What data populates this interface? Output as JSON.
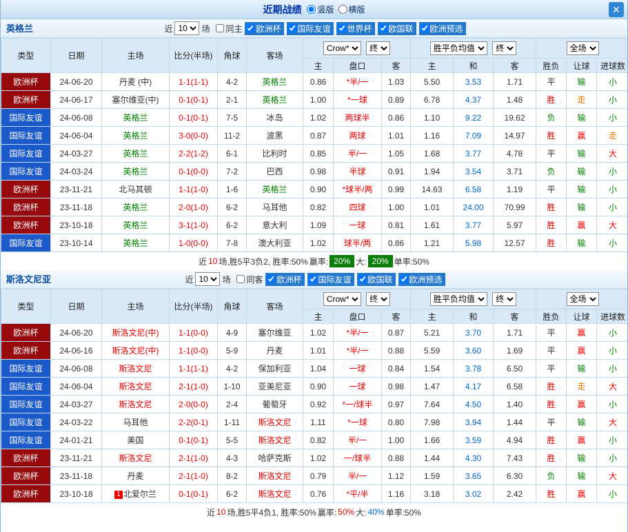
{
  "topbar": {
    "title": "近期战绩",
    "radios": [
      {
        "label": "竖版",
        "selected": true
      },
      {
        "label": "横版",
        "selected": false
      }
    ],
    "close_glyph": "✕"
  },
  "table_header": {
    "col_type": "类型",
    "col_date": "日期",
    "col_home": "主场",
    "col_score": "比分(半场)",
    "col_corner": "角球",
    "col_away": "客场",
    "dd_company": "Crow*",
    "dd_final1": "终",
    "dd_avg": "胜平负均值",
    "dd_final2": "终",
    "dd_scope": "全场",
    "sub": [
      "主",
      "盘口",
      "客",
      "主",
      "和",
      "客",
      "胜负",
      "让球",
      "进球数"
    ]
  },
  "comp_colors": {
    "欧洲杯": "#96090d",
    "国际友谊": "#1d5ac9"
  },
  "sections": [
    {
      "team": "英格兰",
      "filters": {
        "near": "近",
        "count": "10",
        "unit": "场",
        "same_label": "同主",
        "same_checked": false,
        "comps": [
          "欧洲杯",
          "国际友谊",
          "世界杯",
          "欧国联",
          "欧洲预选"
        ]
      },
      "rows": [
        {
          "comp": "欧洲杯",
          "date": "24-06-20",
          "home": "丹麦 (中)",
          "home_color": "black",
          "score": "1-1(1-1)",
          "corner": "4-2",
          "away": "英格兰",
          "away_color": "green",
          "odds_home": "0.86",
          "handicap": "*半/一",
          "odds_away": "1.03",
          "avg_home": "5.50",
          "avg_draw": "3.53",
          "avg_away": "1.71",
          "result": "平",
          "result_color": "black",
          "hcp": "输",
          "hcp_color": "green",
          "goal": "小",
          "goal_color": "green"
        },
        {
          "comp": "欧洲杯",
          "date": "24-06-17",
          "home": "塞尔维亚(中)",
          "home_color": "black",
          "score": "0-1(0-1)",
          "corner": "2-1",
          "away": "英格兰",
          "away_color": "green",
          "odds_home": "1.00",
          "handicap": "*一球",
          "odds_away": "0.89",
          "avg_home": "6.78",
          "avg_draw": "4.37",
          "avg_away": "1.48",
          "result": "胜",
          "result_color": "red",
          "hcp": "走",
          "hcp_color": "orange",
          "goal": "小",
          "goal_color": "green"
        },
        {
          "comp": "国际友谊",
          "date": "24-06-08",
          "home": "英格兰",
          "home_color": "green",
          "score": "0-1(0-1)",
          "corner": "7-5",
          "away": "冰岛",
          "away_color": "black",
          "odds_home": "1.02",
          "handicap": "两球半",
          "odds_away": "0.86",
          "avg_home": "1.10",
          "avg_draw": "9.22",
          "avg_away": "19.62",
          "result": "负",
          "result_color": "green",
          "hcp": "输",
          "hcp_color": "green",
          "goal": "小",
          "goal_color": "green"
        },
        {
          "comp": "国际友谊",
          "date": "24-06-04",
          "home": "英格兰",
          "home_color": "green",
          "score": "3-0(0-0)",
          "corner": "11-2",
          "away": "波黑",
          "away_color": "black",
          "odds_home": "0.87",
          "handicap": "两球",
          "odds_away": "1.01",
          "avg_home": "1.16",
          "avg_draw": "7.09",
          "avg_away": "14.97",
          "result": "胜",
          "result_color": "red",
          "hcp": "赢",
          "hcp_color": "red",
          "goal": "走",
          "goal_color": "orange"
        },
        {
          "comp": "国际友谊",
          "date": "24-03-27",
          "home": "英格兰",
          "home_color": "green",
          "score": "2-2(1-2)",
          "corner": "6-1",
          "away": "比利时",
          "away_color": "black",
          "odds_home": "0.85",
          "handicap": "半/一",
          "odds_away": "1.05",
          "avg_home": "1.68",
          "avg_draw": "3.77",
          "avg_away": "4.78",
          "result": "平",
          "result_color": "black",
          "hcp": "输",
          "hcp_color": "green",
          "goal": "大",
          "goal_color": "red"
        },
        {
          "comp": "国际友谊",
          "date": "24-03-24",
          "home": "英格兰",
          "home_color": "green",
          "score": "0-1(0-0)",
          "corner": "7-2",
          "away": "巴西",
          "away_color": "black",
          "odds_home": "0.98",
          "handicap": "半球",
          "odds_away": "0.91",
          "avg_home": "1.94",
          "avg_draw": "3.54",
          "avg_away": "3.71",
          "result": "负",
          "result_color": "green",
          "hcp": "输",
          "hcp_color": "green",
          "goal": "小",
          "goal_color": "green"
        },
        {
          "comp": "欧洲杯",
          "date": "23-11-21",
          "home": "北马其顿",
          "home_color": "black",
          "score": "1-1(1-0)",
          "corner": "1-6",
          "away": "英格兰",
          "away_color": "green",
          "odds_home": "0.90",
          "handicap": "*球半/两",
          "odds_away": "0.99",
          "avg_home": "14.63",
          "avg_draw": "6.58",
          "avg_away": "1.19",
          "result": "平",
          "result_color": "black",
          "hcp": "输",
          "hcp_color": "green",
          "goal": "小",
          "goal_color": "green"
        },
        {
          "comp": "欧洲杯",
          "date": "23-11-18",
          "home": "英格兰",
          "home_color": "green",
          "score": "2-0(1-0)",
          "corner": "6-2",
          "away": "马耳他",
          "away_color": "black",
          "odds_home": "0.82",
          "handicap": "四球",
          "odds_away": "1.00",
          "avg_home": "1.01",
          "avg_draw": "24.00",
          "avg_away": "70.99",
          "result": "胜",
          "result_color": "red",
          "hcp": "输",
          "hcp_color": "green",
          "goal": "小",
          "goal_color": "green"
        },
        {
          "comp": "欧洲杯",
          "date": "23-10-18",
          "home": "英格兰",
          "home_color": "green",
          "score": "3-1(1-0)",
          "corner": "6-2",
          "away": "意大利",
          "away_color": "black",
          "odds_home": "1.09",
          "handicap": "一球",
          "odds_away": "0.81",
          "avg_home": "1.61",
          "avg_draw": "3.77",
          "avg_away": "5.97",
          "result": "胜",
          "result_color": "red",
          "hcp": "赢",
          "hcp_color": "red",
          "goal": "大",
          "goal_color": "red"
        },
        {
          "comp": "国际友谊",
          "date": "23-10-14",
          "home": "英格兰",
          "home_color": "green",
          "score": "1-0(0-0)",
          "corner": "7-8",
          "away": "澳大利亚",
          "away_color": "black",
          "odds_home": "1.02",
          "handicap": "球半/两",
          "odds_away": "0.86",
          "avg_home": "1.21",
          "avg_draw": "5.98",
          "avg_away": "12.57",
          "result": "胜",
          "result_color": "red",
          "hcp": "输",
          "hcp_color": "green",
          "goal": "小",
          "goal_color": "green"
        }
      ],
      "summary": [
        {
          "text": "近",
          "style": "plain"
        },
        {
          "text": "10",
          "style": "red"
        },
        {
          "text": "场,胜5平3负2, 胜率:50% ",
          "style": "plain"
        },
        {
          "text": "赢率: ",
          "style": "plain"
        },
        {
          "text": "20%",
          "style": "badge-green"
        },
        {
          "text": " 大: ",
          "style": "plain"
        },
        {
          "text": "20%",
          "style": "badge-green"
        },
        {
          "text": " 单率:50%",
          "style": "plain"
        }
      ]
    },
    {
      "team": "斯洛文尼亚",
      "filters": {
        "near": "近",
        "count": "10",
        "unit": "场",
        "same_label": "同客",
        "same_checked": false,
        "comps": [
          "欧洲杯",
          "国际友谊",
          "欧国联",
          "欧洲预选"
        ]
      },
      "rows": [
        {
          "comp": "欧洲杯",
          "date": "24-06-20",
          "home": "斯洛文尼(中)",
          "home_color": "red",
          "score": "1-1(0-0)",
          "corner": "4-9",
          "away": "塞尔维亚",
          "away_color": "black",
          "odds_home": "1.02",
          "handicap": "*半/一",
          "odds_away": "0.87",
          "avg_home": "5.21",
          "avg_draw": "3.70",
          "avg_away": "1.71",
          "result": "平",
          "result_color": "black",
          "hcp": "赢",
          "hcp_color": "red",
          "goal": "小",
          "goal_color": "green"
        },
        {
          "comp": "欧洲杯",
          "date": "24-06-16",
          "home": "斯洛文尼(中)",
          "home_color": "red",
          "score": "1-1(0-0)",
          "corner": "5-9",
          "away": "丹麦",
          "away_color": "black",
          "odds_home": "1.01",
          "handicap": "*半/一",
          "odds_away": "0.88",
          "avg_home": "5.59",
          "avg_draw": "3.60",
          "avg_away": "1.69",
          "result": "平",
          "result_color": "black",
          "hcp": "赢",
          "hcp_color": "red",
          "goal": "小",
          "goal_color": "green"
        },
        {
          "comp": "国际友谊",
          "date": "24-06-08",
          "home": "斯洛文尼",
          "home_color": "red",
          "score": "1-1(1-1)",
          "corner": "4-2",
          "away": "保加利亚",
          "away_color": "black",
          "odds_home": "1.04",
          "handicap": "一球",
          "odds_away": "0.84",
          "avg_home": "1.54",
          "avg_draw": "3.78",
          "avg_away": "6.50",
          "result": "平",
          "result_color": "black",
          "hcp": "输",
          "hcp_color": "green",
          "goal": "小",
          "goal_color": "green"
        },
        {
          "comp": "国际友谊",
          "date": "24-06-04",
          "home": "斯洛文尼",
          "home_color": "red",
          "score": "2-1(1-0)",
          "corner": "1-10",
          "away": "亚美尼亚",
          "away_color": "black",
          "odds_home": "0.90",
          "handicap": "一球",
          "odds_away": "0.98",
          "avg_home": "1.47",
          "avg_draw": "4.17",
          "avg_away": "6.58",
          "result": "胜",
          "result_color": "red",
          "hcp": "走",
          "hcp_color": "orange",
          "goal": "大",
          "goal_color": "red"
        },
        {
          "comp": "国际友谊",
          "date": "24-03-27",
          "home": "斯洛文尼",
          "home_color": "red",
          "score": "2-0(0-0)",
          "corner": "2-4",
          "away": "葡萄牙",
          "away_color": "black",
          "odds_home": "0.92",
          "handicap": "*一/球半",
          "odds_away": "0.97",
          "avg_home": "7.64",
          "avg_draw": "4.50",
          "avg_away": "1.40",
          "result": "胜",
          "result_color": "red",
          "hcp": "赢",
          "hcp_color": "red",
          "goal": "小",
          "goal_color": "green"
        },
        {
          "comp": "国际友谊",
          "date": "24-03-22",
          "home": "马耳他",
          "home_color": "black",
          "score": "2-2(0-1)",
          "corner": "1-11",
          "away": "斯洛文尼",
          "away_color": "red",
          "odds_home": "1.11",
          "handicap": "*一球",
          "odds_away": "0.80",
          "avg_home": "7.98",
          "avg_draw": "3.94",
          "avg_away": "1.44",
          "result": "平",
          "result_color": "black",
          "hcp": "输",
          "hcp_color": "green",
          "goal": "大",
          "goal_color": "red"
        },
        {
          "comp": "国际友谊",
          "date": "24-01-21",
          "home": "美国",
          "home_color": "black",
          "score": "0-1(0-1)",
          "corner": "5-5",
          "away": "斯洛文尼",
          "away_color": "red",
          "odds_home": "0.82",
          "handicap": "半/一",
          "odds_away": "1.00",
          "avg_home": "1.66",
          "avg_draw": "3.59",
          "avg_away": "4.94",
          "result": "胜",
          "result_color": "red",
          "hcp": "赢",
          "hcp_color": "red",
          "goal": "小",
          "goal_color": "green"
        },
        {
          "comp": "欧洲杯",
          "date": "23-11-21",
          "home": "斯洛文尼",
          "home_color": "red",
          "score": "2-1(1-0)",
          "corner": "4-3",
          "away": "哈萨克斯",
          "away_color": "black",
          "odds_home": "1.02",
          "handicap": "一/球半",
          "odds_away": "0.88",
          "avg_home": "1.44",
          "avg_draw": "4.30",
          "avg_away": "7.43",
          "result": "胜",
          "result_color": "red",
          "hcp": "输",
          "hcp_color": "green",
          "goal": "小",
          "goal_color": "green"
        },
        {
          "comp": "欧洲杯",
          "date": "23-11-18",
          "home": "丹麦",
          "home_color": "black",
          "score": "2-1(1-0)",
          "corner": "8-2",
          "away": "斯洛文尼",
          "away_color": "red",
          "odds_home": "0.79",
          "handicap": "半/一",
          "odds_away": "1.12",
          "avg_home": "1.59",
          "avg_draw": "3.65",
          "avg_away": "6.30",
          "result": "负",
          "result_color": "green",
          "hcp": "输",
          "hcp_color": "green",
          "goal": "大",
          "goal_color": "red"
        },
        {
          "comp": "欧洲杯",
          "date": "23-10-18",
          "home": "北爱尔兰",
          "home_badge": "1",
          "home_color": "black",
          "score": "0-1(0-1)",
          "corner": "6-2",
          "away": "斯洛文尼",
          "away_color": "red",
          "odds_home": "0.76",
          "handicap": "*平/半",
          "odds_away": "1.16",
          "avg_home": "3.18",
          "avg_draw": "3.02",
          "avg_away": "2.42",
          "result": "胜",
          "result_color": "red",
          "hcp": "赢",
          "hcp_color": "red",
          "goal": "小",
          "goal_color": "green"
        }
      ],
      "summary": [
        {
          "text": "近",
          "style": "plain"
        },
        {
          "text": "10",
          "style": "red"
        },
        {
          "text": "场,胜5平4负1, 胜率:50% ",
          "style": "plain"
        },
        {
          "text": "赢率:",
          "style": "plain"
        },
        {
          "text": "50%",
          "style": "red"
        },
        {
          "text": " 大:",
          "style": "plain"
        },
        {
          "text": "40%",
          "style": "blue"
        },
        {
          "text": " 单率:50%",
          "style": "plain"
        }
      ]
    }
  ]
}
